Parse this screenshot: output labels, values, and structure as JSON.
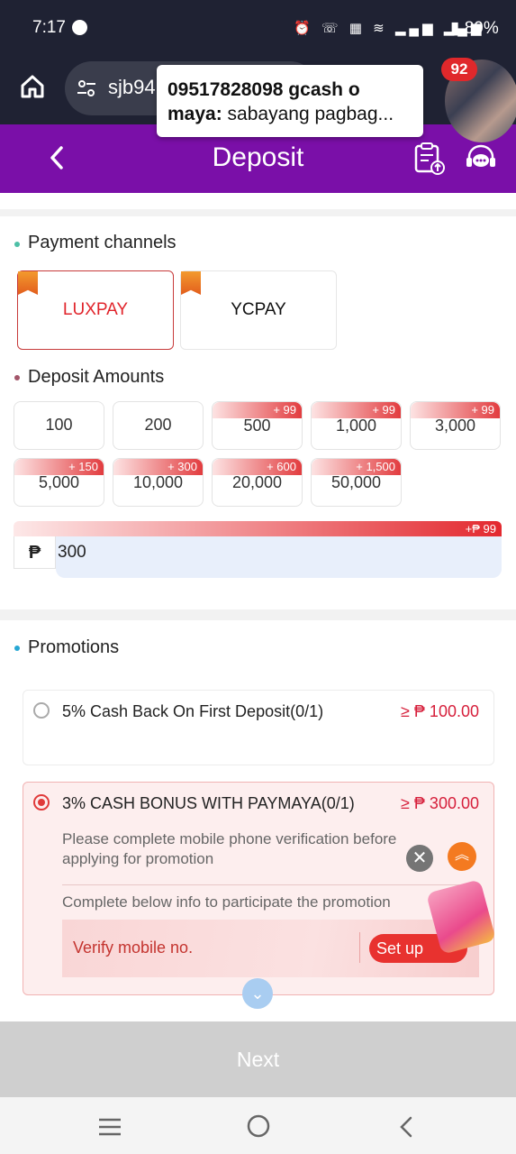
{
  "status": {
    "time": "7:17",
    "icons": "⏰ ☏ ▦ ≋ ▂▄▆ ▂▄▆",
    "battery": "▮ 89%"
  },
  "browser": {
    "url": "sjb94",
    "notif_badge": "92"
  },
  "notification": {
    "title": "09517828098 gcash o",
    "sender": "maya:",
    "preview": "sabayang pagbag..."
  },
  "header": {
    "title": "Deposit"
  },
  "channels": {
    "title": "Payment channels",
    "items": [
      {
        "label": "LUXPAY",
        "selected": true
      },
      {
        "label": "YCPAY",
        "selected": false
      }
    ]
  },
  "amounts": {
    "title": "Deposit Amounts",
    "items": [
      {
        "value": "100",
        "bonus": ""
      },
      {
        "value": "200",
        "bonus": ""
      },
      {
        "value": "500",
        "bonus": "+ 99"
      },
      {
        "value": "1,000",
        "bonus": "+ 99"
      },
      {
        "value": "3,000",
        "bonus": "+ 99"
      },
      {
        "value": "5,000",
        "bonus": "+ 150"
      },
      {
        "value": "10,000",
        "bonus": "+ 300"
      },
      {
        "value": "20,000",
        "bonus": "+ 600"
      },
      {
        "value": "50,000",
        "bonus": "+ 1,500"
      }
    ],
    "custom_currency": "₱",
    "custom_value": "300",
    "custom_bonus": "+₱ 99"
  },
  "promotions": {
    "title": "Promotions",
    "items": [
      {
        "name": "5% Cash Back On First Deposit(0/1)",
        "min": "≥ ₱ 100.00",
        "selected": false
      },
      {
        "name": "3% CASH BONUS WITH PAYMAYA(0/1)",
        "min": "≥ ₱ 300.00",
        "selected": true
      }
    ],
    "notice": "Please complete mobile phone verification before applying for promotion",
    "complete_info": "Complete below info to participate the promotion",
    "verify_label": "Verify mobile no.",
    "setup_label": "Set up"
  },
  "footer": {
    "next_label": "Next"
  },
  "colors": {
    "purple": "#7a0fa8",
    "red": "#e1252c",
    "teal": "#4dbfa6",
    "price": "#d61f3b"
  }
}
